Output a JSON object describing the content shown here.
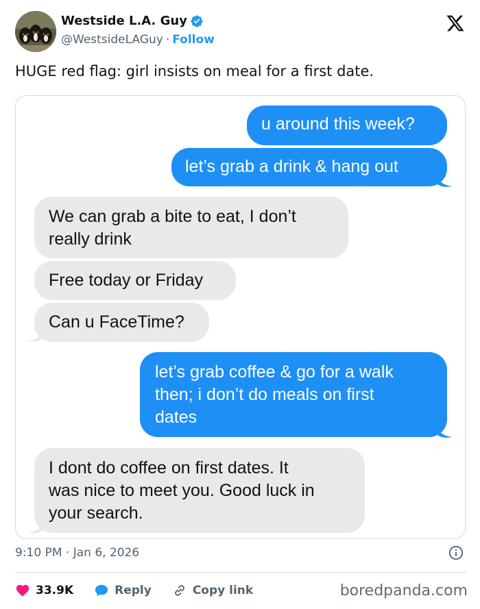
{
  "header": {
    "display_name": "Westside L.A. Guy",
    "handle": "@WestsideLAGuy",
    "separator": "·",
    "follow_label": "Follow"
  },
  "tweet": {
    "text": "HUGE red flag: girl insists on meal for a first date."
  },
  "conversation": [
    {
      "from": "me",
      "lines": [
        "u around this week?"
      ]
    },
    {
      "from": "me",
      "lines": [
        "let’s grab a drink & hang out"
      ]
    },
    {
      "from": "them",
      "lines": [
        "We can grab a bite to eat, I don’t",
        "really drink"
      ]
    },
    {
      "from": "them",
      "lines": [
        "Free today or Friday"
      ]
    },
    {
      "from": "them",
      "lines": [
        "Can u FaceTime?"
      ]
    },
    {
      "from": "me",
      "lines": [
        "let’s grab coffee & go for a walk",
        "then; i don’t do meals on first",
        "dates"
      ]
    },
    {
      "from": "them",
      "lines": [
        "I dont do coffee on first dates. It",
        "was nice to meet you. Good luck in",
        "your search."
      ]
    }
  ],
  "meta": {
    "time": "9:10 PM",
    "separator": "·",
    "date": "Jan 6, 2026"
  },
  "actions": {
    "likes": "33.9K",
    "reply_label": "Reply",
    "copy_link_label": "Copy link"
  },
  "watermark": "boredpanda.com",
  "colors": {
    "brand_blue": "#1d9bf0",
    "outgoing_bubble": "#1e8ff5",
    "incoming_bubble": "#e9e9eb",
    "like_heart": "#f91880",
    "secondary_text": "#536471"
  },
  "icons": {
    "verified": "verified-badge-icon",
    "logo": "x-logo-icon",
    "info": "info-icon",
    "like": "heart-icon",
    "reply": "speech-bubble-icon",
    "copy_link": "link-icon"
  }
}
